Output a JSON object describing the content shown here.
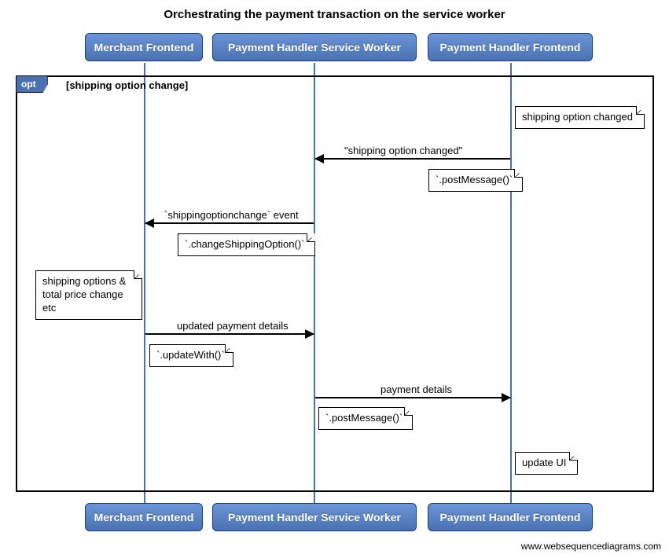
{
  "title": "Orchestrating the payment transaction on the service worker",
  "participants": {
    "p1": "Merchant Frontend",
    "p2": "Payment Handler Service Worker",
    "p3": "Payment Handler Frontend"
  },
  "fragment": {
    "type": "opt",
    "condition": "[shipping option change]"
  },
  "notes": {
    "n1": "shipping option changed",
    "n2": "`.postMessage()`",
    "n3": "`.changeShippingOption()`",
    "n4": "shipping options & total price change etc",
    "n5": "`.updateWith()`",
    "n6": "`.postMessage()`",
    "n7": "update UI"
  },
  "messages": {
    "m1": "\"shipping option changed\"",
    "m2": "`shippingoptionchange` event",
    "m3": "updated payment details",
    "m4": "payment details"
  },
  "attribution": "www.websequencediagrams.com",
  "chart_data": {
    "type": "sequence-diagram",
    "title": "Orchestrating the payment transaction on the service worker",
    "participants": [
      "Merchant Frontend",
      "Payment Handler Service Worker",
      "Payment Handler Frontend"
    ],
    "fragments": [
      {
        "type": "opt",
        "condition": "shipping option change",
        "steps": [
          {
            "type": "note",
            "over": "Payment Handler Frontend",
            "text": "shipping option changed"
          },
          {
            "type": "message",
            "from": "Payment Handler Frontend",
            "to": "Payment Handler Service Worker",
            "label": "\"shipping option changed\""
          },
          {
            "type": "note",
            "over": "Payment Handler Frontend",
            "text": "`.postMessage()`"
          },
          {
            "type": "message",
            "from": "Payment Handler Service Worker",
            "to": "Merchant Frontend",
            "label": "`shippingoptionchange` event"
          },
          {
            "type": "note",
            "over": "Payment Handler Service Worker",
            "text": "`.changeShippingOption()`"
          },
          {
            "type": "note",
            "over": "Merchant Frontend",
            "text": "shipping options & total price change etc"
          },
          {
            "type": "message",
            "from": "Merchant Frontend",
            "to": "Payment Handler Service Worker",
            "label": "updated payment details"
          },
          {
            "type": "note",
            "over": "Merchant Frontend",
            "text": "`.updateWith()`"
          },
          {
            "type": "message",
            "from": "Payment Handler Service Worker",
            "to": "Payment Handler Frontend",
            "label": "payment details"
          },
          {
            "type": "note",
            "over": "Payment Handler Service Worker",
            "text": "`.postMessage()`"
          },
          {
            "type": "note",
            "over": "Payment Handler Frontend",
            "text": "update UI"
          }
        ]
      }
    ]
  }
}
